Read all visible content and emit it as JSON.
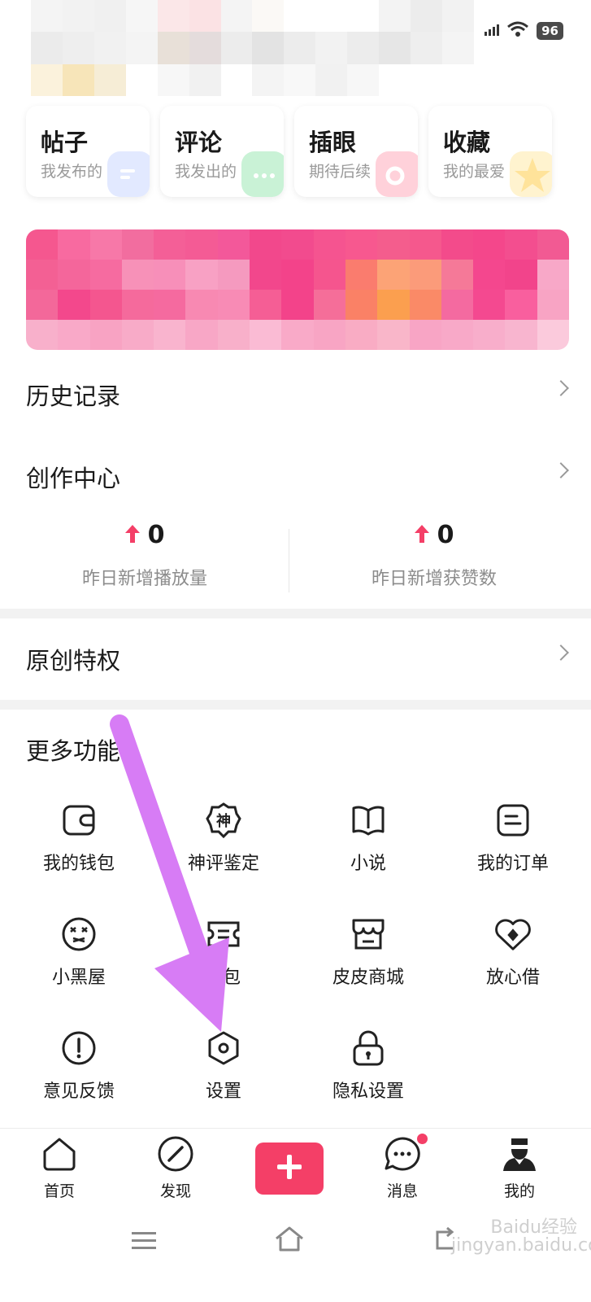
{
  "status_bar": {
    "battery": "96"
  },
  "quick_cards": [
    {
      "title": "帖子",
      "subtitle": "我发布的",
      "color": "#dce6ff"
    },
    {
      "title": "评论",
      "subtitle": "我发出的",
      "color": "#c9f2d6"
    },
    {
      "title": "插眼",
      "subtitle": "期待后续",
      "color": "#ffd6de"
    },
    {
      "title": "收藏",
      "subtitle": "我的最爱",
      "color": "#fff0c8"
    }
  ],
  "menu": {
    "history": "历史记录",
    "creation_center": "创作中心",
    "original_privilege": "原创特权"
  },
  "stats": [
    {
      "value": "0",
      "label": "昨日新增播放量"
    },
    {
      "value": "0",
      "label": "昨日新增获赞数"
    }
  ],
  "more": {
    "title": "更多功能",
    "items": [
      {
        "label": "我的钱包",
        "icon": "wallet-icon"
      },
      {
        "label": "神评鉴定",
        "icon": "shen-badge-icon",
        "glyph": "神"
      },
      {
        "label": "小说",
        "icon": "book-icon"
      },
      {
        "label": "我的订单",
        "icon": "order-icon"
      },
      {
        "label": "小黑屋",
        "icon": "dizzy-face-icon"
      },
      {
        "label": "包",
        "icon": "ticket-icon"
      },
      {
        "label": "皮皮商城",
        "icon": "shop-icon"
      },
      {
        "label": "放心借",
        "icon": "heart-diamond-icon"
      },
      {
        "label": "意见反馈",
        "icon": "exclamation-icon"
      },
      {
        "label": "设置",
        "icon": "settings-hex-icon"
      },
      {
        "label": "隐私设置",
        "icon": "lock-icon"
      }
    ]
  },
  "bottom_nav": [
    {
      "label": "首页",
      "icon": "home-icon"
    },
    {
      "label": "发现",
      "icon": "compass-icon"
    },
    {
      "label": "",
      "icon": "plus-icon"
    },
    {
      "label": "消息",
      "icon": "message-icon"
    },
    {
      "label": "我的",
      "icon": "profile-icon"
    }
  ],
  "colors": {
    "accent": "#f43f67",
    "arrow": "#d77cf5"
  },
  "watermark": "Baidu经验 jingyan.baidu.com"
}
